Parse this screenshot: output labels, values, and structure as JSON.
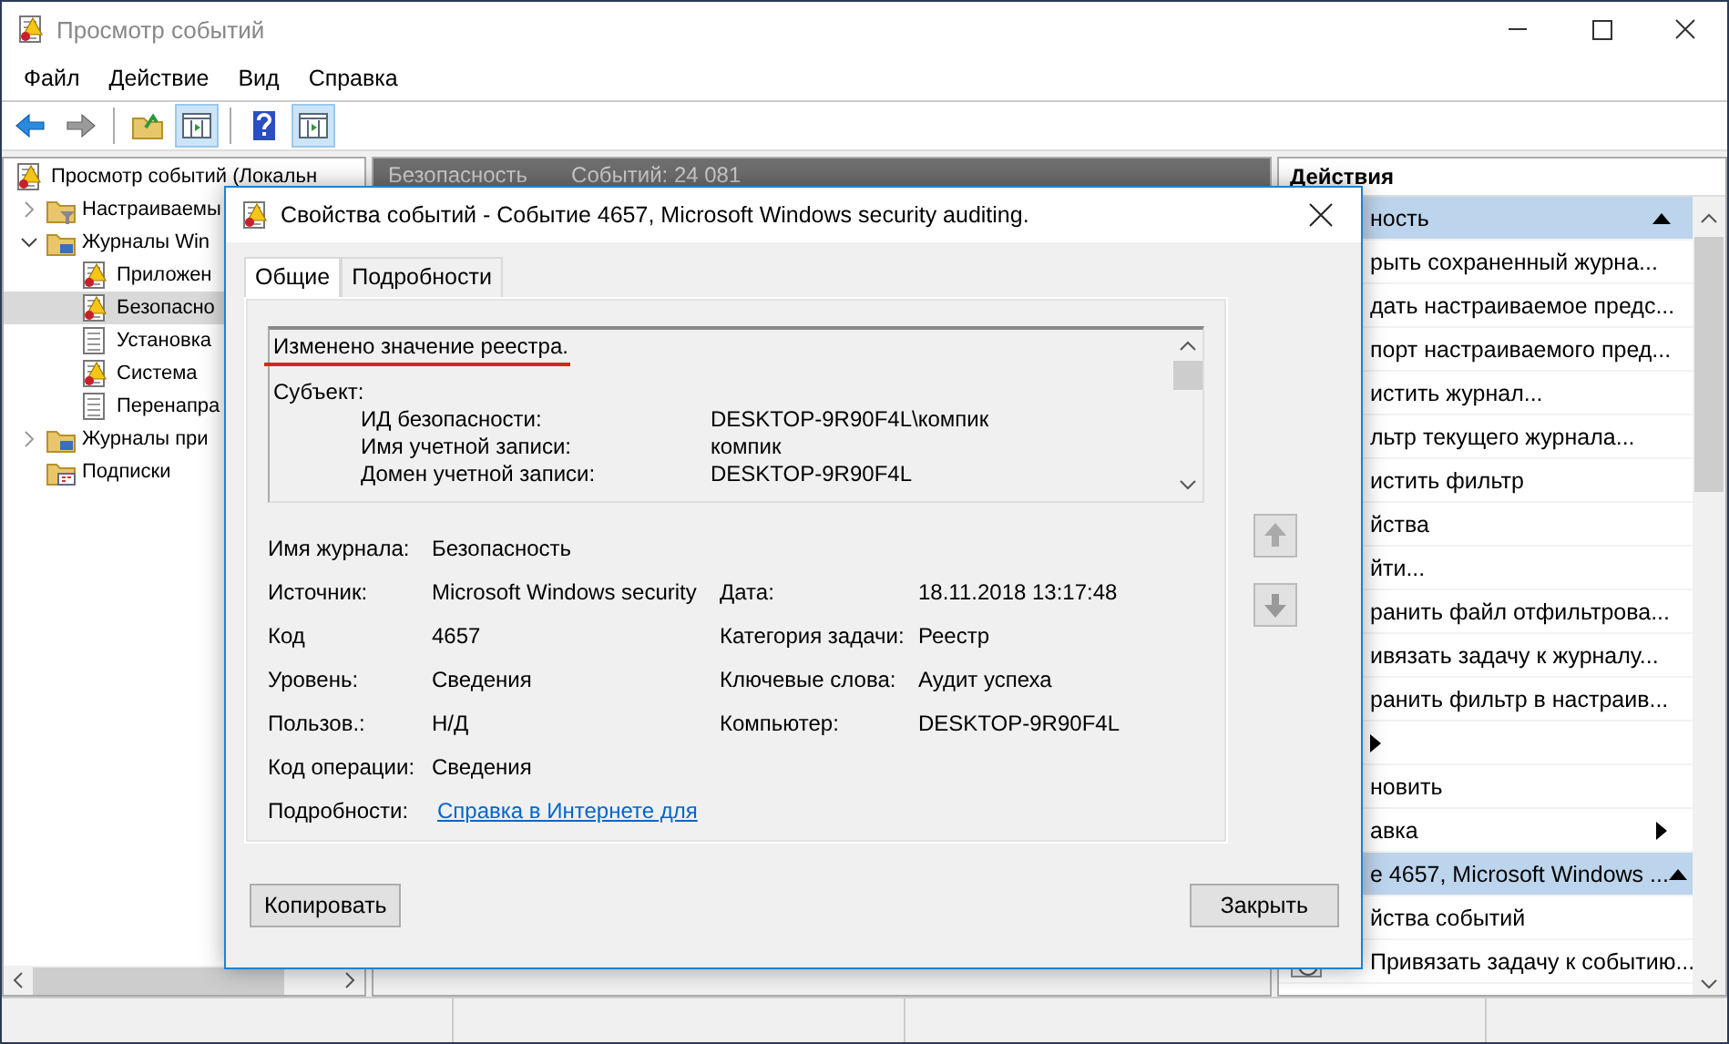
{
  "window": {
    "title": "Просмотр событий"
  },
  "menu": [
    "Файл",
    "Действие",
    "Вид",
    "Справка"
  ],
  "toolbar": [
    {
      "kind": "back",
      "pressed": false
    },
    {
      "kind": "forward",
      "pressed": false
    },
    {
      "kind": "folder",
      "pressed": false
    },
    {
      "kind": "panel",
      "pressed": true
    },
    {
      "kind": "help",
      "pressed": false
    },
    {
      "kind": "panel",
      "pressed": true
    }
  ],
  "tree": {
    "label": "Просмотр событий (Локальн",
    "selected": false,
    "children": [
      {
        "label": "Настраиваемы",
        "kind": "filter-folder",
        "expanded": false,
        "selected": false
      },
      {
        "label": "Журналы Win",
        "kind": "folder",
        "expanded": true,
        "selected": false,
        "children": [
          {
            "label": "Приложен",
            "kind": "log",
            "selected": false
          },
          {
            "label": "Безопасно",
            "kind": "log",
            "selected": true
          },
          {
            "label": "Установка",
            "kind": "plain-log",
            "selected": false
          },
          {
            "label": "Система",
            "kind": "log",
            "selected": false
          },
          {
            "label": "Перенапра",
            "kind": "plain-log",
            "selected": false
          }
        ]
      },
      {
        "label": "Журналы при",
        "kind": "folder",
        "expanded": false,
        "selected": false
      },
      {
        "label": "Подписки",
        "kind": "subscriptions",
        "selected": false
      }
    ]
  },
  "middle": {
    "title": "Безопасность",
    "count": "Событий: 24 081"
  },
  "actions": {
    "title": "Действия",
    "items": [
      {
        "kind": "section",
        "label": "ность",
        "expanded": true
      },
      {
        "kind": "item",
        "label": "рыть сохраненный журна..."
      },
      {
        "kind": "item",
        "label": "дать настраиваемое предс..."
      },
      {
        "kind": "item",
        "label": "порт настраиваемого пред..."
      },
      {
        "kind": "item",
        "label": "истить журнал..."
      },
      {
        "kind": "item",
        "label": "льтр текущего журнала..."
      },
      {
        "kind": "item",
        "label": "истить фильтр"
      },
      {
        "kind": "item",
        "label": "йства"
      },
      {
        "kind": "item",
        "label": "йти..."
      },
      {
        "kind": "item",
        "label": "ранить файл отфильтрова..."
      },
      {
        "kind": "item",
        "label": "ивязать задачу к журналу..."
      },
      {
        "kind": "item",
        "label": "ранить фильтр в настраив..."
      },
      {
        "kind": "submenu"
      },
      {
        "kind": "item",
        "label": "новить"
      },
      {
        "kind": "submenu",
        "label": "авка"
      },
      {
        "kind": "section",
        "label": "е 4657, Microsoft Windows ...",
        "expanded": true
      },
      {
        "kind": "item",
        "label": "йства событий"
      },
      {
        "kind": "task",
        "label": "Привязать задачу к событию..."
      }
    ]
  },
  "dialog": {
    "title": "Свойства событий - Событие 4657, Microsoft Windows security auditing.",
    "tabs": [
      {
        "label": "Общие",
        "selected": true
      },
      {
        "label": "Подробности",
        "selected": false
      }
    ],
    "message": {
      "headline": "Изменено значение реестра.",
      "highlighted": true,
      "section": "Субъект:",
      "rows": [
        {
          "label": "ИД безопасности:",
          "value": "DESKTOP-9R90F4L\\компик"
        },
        {
          "label": "Имя учетной записи:",
          "value": "компик"
        },
        {
          "label": "Домен учетной записи:",
          "value": "DESKTOP-9R90F4L"
        }
      ]
    },
    "fields": [
      {
        "left": {
          "label": "Имя журнала:",
          "value": "Безопасность"
        }
      },
      {
        "left": {
          "label": "Источник:",
          "value": "Microsoft Windows security"
        },
        "right": {
          "label": "Дата:",
          "value": "18.11.2018 13:17:48"
        }
      },
      {
        "left": {
          "label": "Код",
          "value": "4657"
        },
        "right": {
          "label": "Категория задачи:",
          "value": "Реестр"
        }
      },
      {
        "left": {
          "label": "Уровень:",
          "value": "Сведения"
        },
        "right": {
          "label": "Ключевые слова:",
          "value": "Аудит успеха"
        }
      },
      {
        "left": {
          "label": "Пользов.:",
          "value": "Н/Д"
        },
        "right": {
          "label": "Компьютер:",
          "value": "DESKTOP-9R90F4L"
        }
      },
      {
        "left": {
          "label": "Код операции:",
          "value": "Сведения"
        }
      },
      {
        "left": {
          "label": "Подробности:",
          "link": "Справка в Интернете для "
        }
      }
    ],
    "buttons": [
      {
        "kind": "copy",
        "label": "Копировать"
      },
      {
        "kind": "close",
        "label": "Закрыть"
      }
    ]
  }
}
